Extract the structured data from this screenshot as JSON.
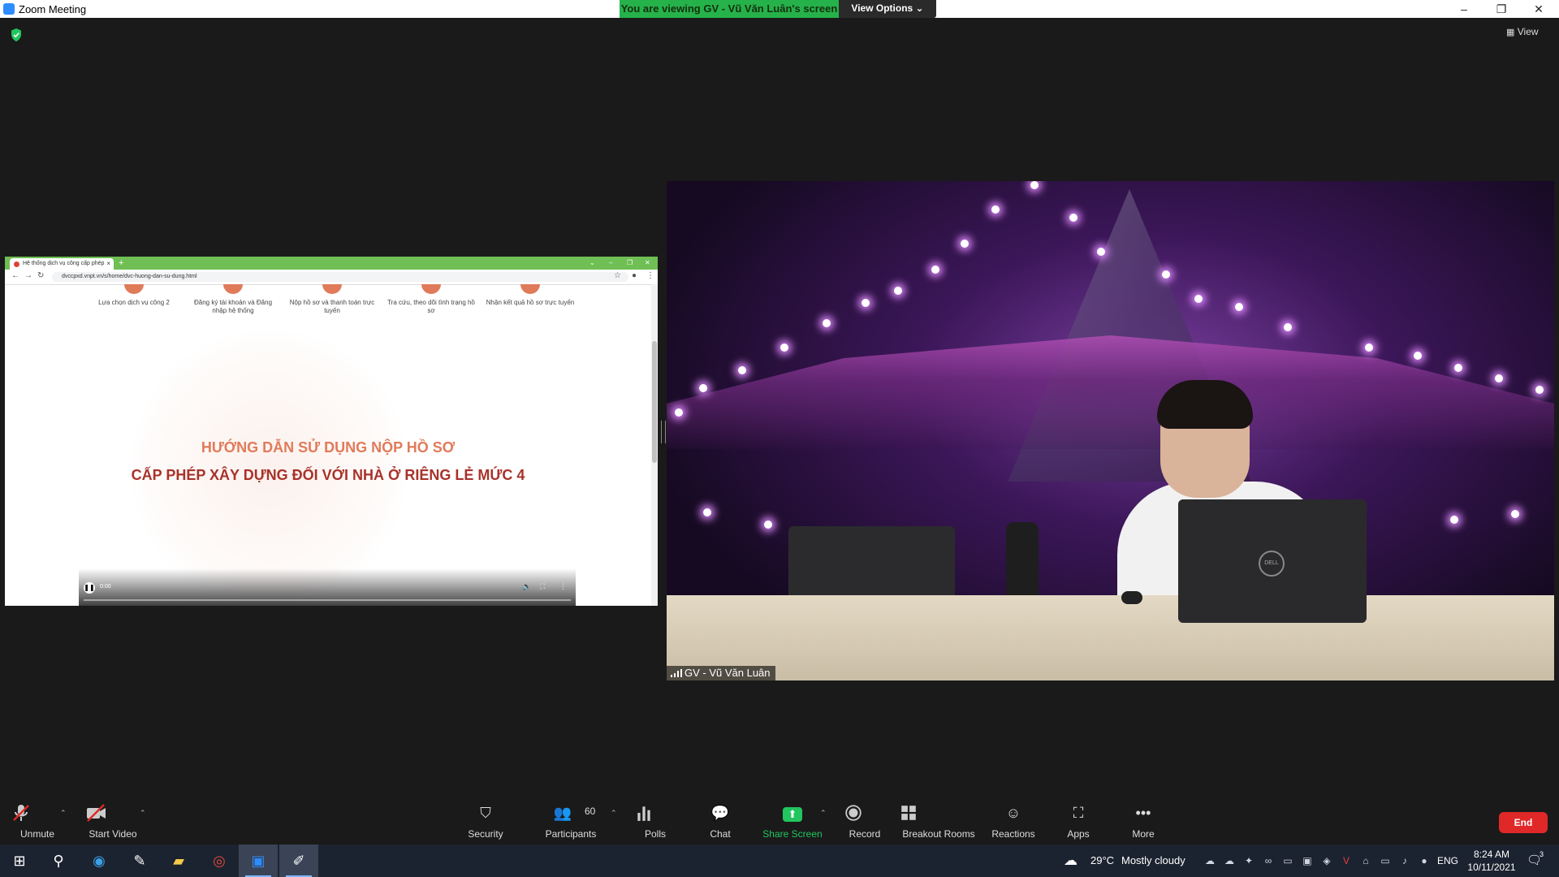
{
  "window": {
    "title": "Zoom Meeting",
    "controls": {
      "minimize": "–",
      "restore": "❐",
      "close": "✕"
    }
  },
  "banner": {
    "viewing_text": "You are viewing GV - Vũ Văn Luân's screen",
    "view_options": "View Options ⌄"
  },
  "view_button": "View",
  "shared_screen": {
    "tab_title": "Hệ thống dịch vụ công cấp phép",
    "tab_close": "×",
    "new_tab": "+",
    "url": "dvccpxd.vnpt.vn/s/home/dvc-huong-dan-su-dung.html",
    "steps": [
      {
        "label": "Lựa chọn dịch vụ công 2"
      },
      {
        "label": "Đăng ký tài khoản và Đăng nhập hệ thống"
      },
      {
        "label": "Nộp hồ sơ và thanh toán trực tuyến"
      },
      {
        "label": "Tra cứu, theo dõi tình trạng hồ sơ"
      },
      {
        "label": "Nhận kết quả hồ sơ trực tuyến"
      }
    ],
    "video_title_line1": "HƯỚNG DẪN SỬ DỤNG NỘP HỒ SƠ",
    "video_title_line2": "CẤP PHÉP XÂY DỰNG ĐỐI VỚI NHÀ Ở RIÊNG LẺ MỨC 4",
    "video_time": "0:00"
  },
  "webcam": {
    "name": "GV - Vũ Văn Luân",
    "laptop_brand": "DELL"
  },
  "toolbar": {
    "unmute": "Unmute",
    "start_video": "Start Video",
    "security": "Security",
    "participants": "Participants",
    "participants_count": "60",
    "polls": "Polls",
    "chat": "Chat",
    "share_screen": "Share Screen",
    "record": "Record",
    "breakout_rooms": "Breakout Rooms",
    "reactions": "Reactions",
    "apps": "Apps",
    "more": "More",
    "end": "End"
  },
  "taskbar": {
    "weather_temp": "29°C",
    "weather_desc": "Mostly cloudy",
    "language": "ENG",
    "time": "8:24 AM",
    "date": "10/11/2021",
    "notifications": "3"
  },
  "colors": {
    "banner_green": "#26b24a",
    "end_red": "#e02828",
    "share_green": "#22c55e",
    "toolbar_bg": "#1a1a1a"
  }
}
